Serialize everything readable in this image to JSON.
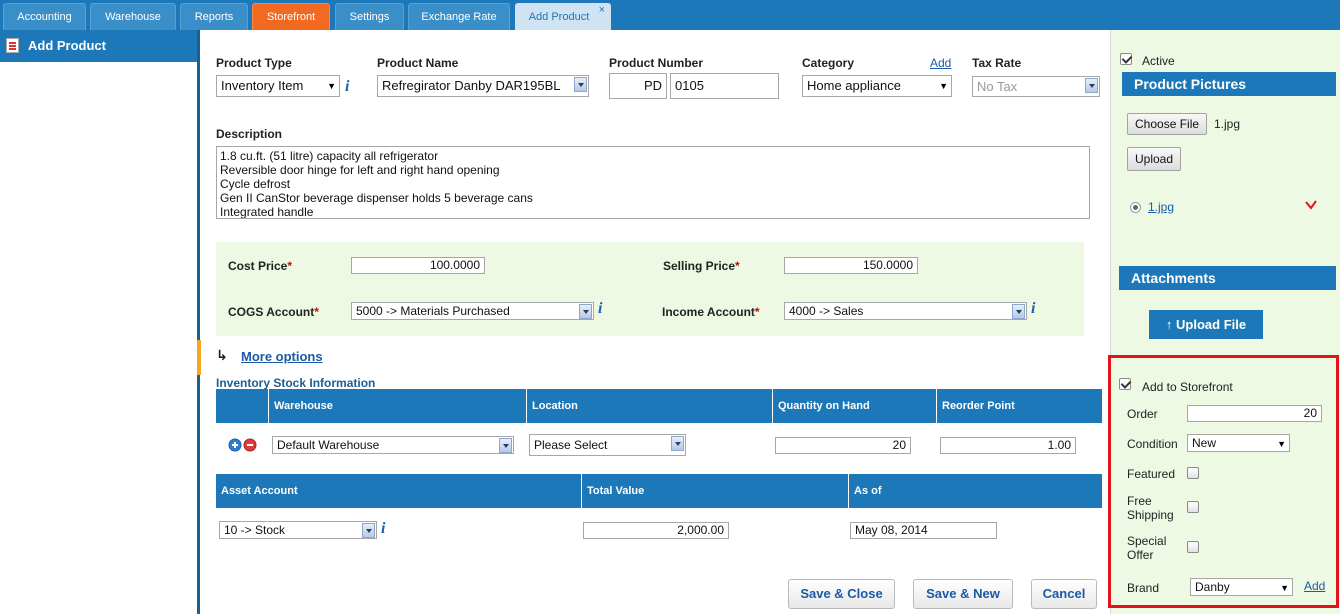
{
  "tabs": [
    {
      "label": "Accounting"
    },
    {
      "label": "Warehouse"
    },
    {
      "label": "Reports"
    },
    {
      "label": "Storefront"
    },
    {
      "label": "Settings"
    },
    {
      "label": "Exchange Rate"
    },
    {
      "label": "Add Product",
      "close": "×"
    }
  ],
  "sidebar": {
    "title": "Add Product"
  },
  "form": {
    "product_type": {
      "label": "Product Type",
      "value": "Inventory Item"
    },
    "product_name": {
      "label": "Product Name",
      "value": "Refregirator Danby DAR195BL"
    },
    "product_number": {
      "label": "Product Number",
      "prefix": "PD",
      "value": "0105"
    },
    "category": {
      "label": "Category",
      "add": "Add",
      "value": "Home appliance"
    },
    "tax_rate": {
      "label": "Tax Rate",
      "value": "No Tax"
    },
    "description": {
      "label": "Description",
      "value": "1.8 cu.ft. (51 litre) capacity all refrigerator\nReversible door hinge for left and right hand opening\nCycle defrost\nGen II CanStor beverage dispenser holds 5 beverage cans\nIntegrated handle"
    },
    "cost_price": {
      "label": "Cost Price",
      "req": "*",
      "value": "100.0000"
    },
    "selling_price": {
      "label": "Selling Price",
      "req": "*",
      "value": "150.0000"
    },
    "cogs_account": {
      "label": "COGS Account",
      "req": "*",
      "value": "5000 -> Materials Purchased"
    },
    "income_account": {
      "label": "Income Account",
      "req": "*",
      "value": "4000 -> Sales"
    },
    "more_options": "More options",
    "more_arrow": "↳"
  },
  "inventory": {
    "title": "Inventory Stock Information",
    "columns": [
      "Warehouse",
      "Location",
      "Quantity on Hand",
      "Reorder Point"
    ],
    "row": {
      "warehouse": "Default Warehouse",
      "location": "Please Select",
      "qty": "20",
      "reorder": "1.00"
    },
    "asset_columns": [
      "Asset Account",
      "Total Value",
      "As of"
    ],
    "asset_row": {
      "account": "10 -> Stock",
      "total": "2,000.00",
      "as_of": "May 08, 2014"
    }
  },
  "buttons": {
    "save_close": "Save & Close",
    "save_new": "Save & New",
    "cancel": "Cancel"
  },
  "right": {
    "active": "Active",
    "pictures_title": "Product Pictures",
    "choose_file": "Choose File",
    "chosen_file": "1.jpg",
    "upload": "Upload",
    "picture_link": "1.jpg",
    "attachments_title": "Attachments",
    "upload_file": "Upload File",
    "upload_icon": "↑",
    "storefront": {
      "add_to_storefront": "Add to Storefront",
      "order_label": "Order",
      "order_value": "20",
      "condition_label": "Condition",
      "condition_value": "New",
      "featured": "Featured",
      "free_shipping": "Free\nShipping",
      "special_offer": "Special\nOffer",
      "brand_label": "Brand",
      "brand_value": "Danby",
      "brand_add": "Add"
    }
  },
  "colors": {
    "primary": "#1c78b8",
    "storefront_tab": "#f26a22",
    "highlight": "#e0141b",
    "panel_bg": "#eef9e3"
  }
}
